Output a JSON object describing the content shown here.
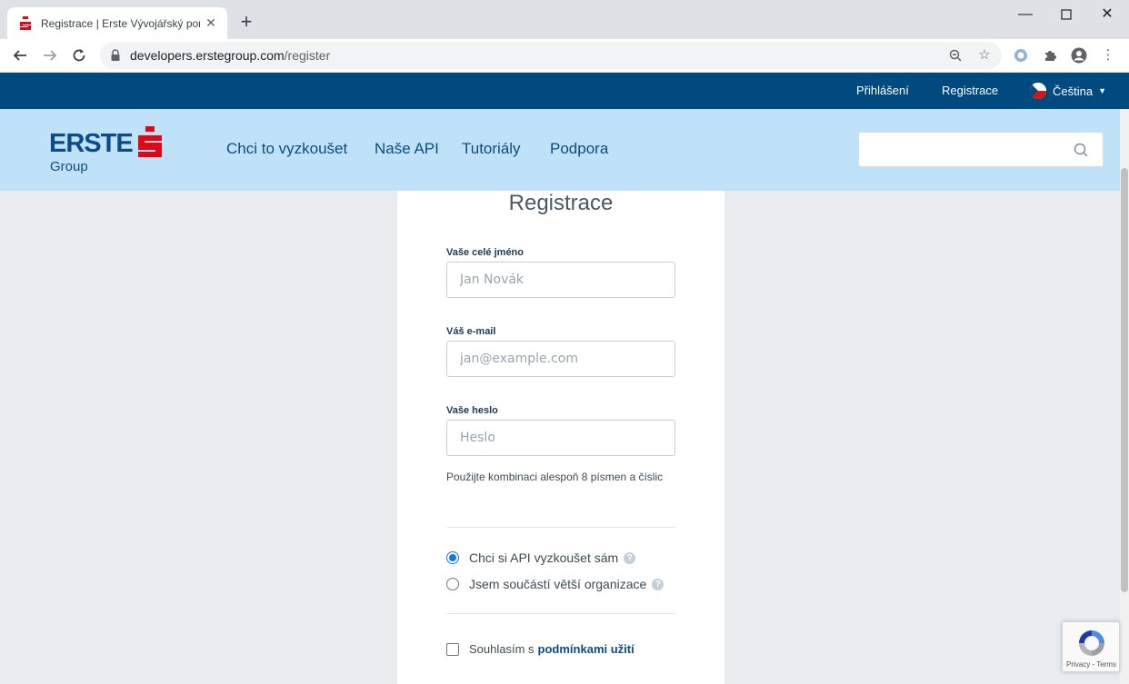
{
  "browser": {
    "tab_title": "Registrace | Erste Vývojářský port",
    "url_host": "developers.erstegroup.com",
    "url_path": "/register"
  },
  "site": {
    "top_links": {
      "login": "Přihlášení",
      "register": "Registrace",
      "language": "Čeština"
    },
    "logo": {
      "name": "ERSTE",
      "sub": "Group"
    },
    "nav": [
      {
        "label": "Chci to vyzkoušet"
      },
      {
        "label": "Naše API"
      },
      {
        "label": "Tutoriály"
      },
      {
        "label": "Podpora"
      }
    ],
    "search": {
      "placeholder": ""
    }
  },
  "form": {
    "title": "Registrace",
    "name": {
      "label": "Vaše celé jméno",
      "placeholder": "Jan Novák"
    },
    "email": {
      "label": "Váš e-mail",
      "placeholder": "jan@example.com"
    },
    "password": {
      "label": "Vaše heslo",
      "placeholder": "Heslo"
    },
    "password_hint": "Použijte kombinaci alespoň 8 písmen a číslic",
    "options": [
      {
        "label": "Chci si API vyzkoušet sám",
        "checked": true
      },
      {
        "label": "Jsem součástí větší organizace",
        "checked": false
      }
    ],
    "terms_prefix": "Souhlasím s",
    "terms_link": "podmínkami užití"
  },
  "recaptcha": {
    "text": "Privacy - Terms"
  },
  "colors": {
    "brand_dark": "#004a7f",
    "brand_light": "#c0e2f9",
    "erste_red": "#e30613",
    "erste_blue": "#0b4b86"
  }
}
